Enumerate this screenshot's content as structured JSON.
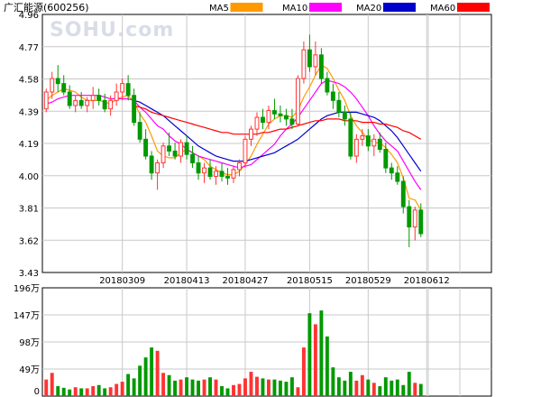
{
  "title": "广汇能源(600256)",
  "watermark": "SOHU.com",
  "legend": [
    {
      "label": "MA5",
      "color": "#ff9900"
    },
    {
      "label": "MA10",
      "color": "#ff00ff"
    },
    {
      "label": "MA20",
      "color": "#0000cc"
    },
    {
      "label": "MA60",
      "color": "#ff0000"
    }
  ],
  "colors": {
    "up": "#ff3333",
    "down": "#009900",
    "grid": "#c8c8c8",
    "border": "#000000"
  },
  "chart_data": [
    {
      "type": "candlestick",
      "price_ticks": [
        "4.96",
        "4.77",
        "4.58",
        "4.39",
        "4.19",
        "4.00",
        "3.81",
        "3.62",
        "3.43"
      ],
      "ylim": [
        3.43,
        4.96
      ],
      "date_labels": [
        {
          "label": "20180309",
          "index": 13
        },
        {
          "label": "20180413",
          "index": 24
        },
        {
          "label": "20180427",
          "index": 34
        },
        {
          "label": "20180515",
          "index": 45
        },
        {
          "label": "20180529",
          "index": 55
        },
        {
          "label": "20180612",
          "index": 65
        }
      ],
      "ohlc": [
        [
          4.4,
          4.52,
          4.38,
          4.5
        ],
        [
          4.5,
          4.62,
          4.46,
          4.58
        ],
        [
          4.58,
          4.66,
          4.5,
          4.55
        ],
        [
          4.55,
          4.6,
          4.48,
          4.5
        ],
        [
          4.5,
          4.54,
          4.4,
          4.42
        ],
        [
          4.42,
          4.48,
          4.38,
          4.45
        ],
        [
          4.45,
          4.5,
          4.4,
          4.42
        ],
        [
          4.42,
          4.47,
          4.38,
          4.45
        ],
        [
          4.45,
          4.53,
          4.4,
          4.48
        ],
        [
          4.48,
          4.52,
          4.42,
          4.45
        ],
        [
          4.45,
          4.49,
          4.38,
          4.4
        ],
        [
          4.4,
          4.48,
          4.36,
          4.45
        ],
        [
          4.45,
          4.55,
          4.42,
          4.5
        ],
        [
          4.5,
          4.58,
          4.45,
          4.55
        ],
        [
          4.55,
          4.6,
          4.45,
          4.48
        ],
        [
          4.48,
          4.52,
          4.3,
          4.32
        ],
        [
          4.32,
          4.38,
          4.2,
          4.22
        ],
        [
          4.22,
          4.28,
          4.1,
          4.12
        ],
        [
          4.12,
          4.15,
          3.98,
          4.02
        ],
        [
          4.02,
          4.1,
          3.92,
          4.08
        ],
        [
          4.08,
          4.2,
          4.05,
          4.18
        ],
        [
          4.18,
          4.26,
          4.12,
          4.15
        ],
        [
          4.15,
          4.2,
          4.1,
          4.12
        ],
        [
          4.12,
          4.22,
          4.08,
          4.2
        ],
        [
          4.2,
          4.24,
          4.1,
          4.13
        ],
        [
          4.13,
          4.18,
          4.05,
          4.08
        ],
        [
          4.08,
          4.12,
          3.98,
          4.02
        ],
        [
          4.02,
          4.08,
          3.96,
          4.05
        ],
        [
          4.05,
          4.1,
          3.98,
          4.0
        ],
        [
          4.0,
          4.06,
          3.95,
          4.03
        ],
        [
          4.03,
          4.08,
          3.97,
          4.0
        ],
        [
          4.0,
          4.05,
          3.95,
          3.99
        ],
        [
          3.99,
          4.06,
          3.96,
          4.04
        ],
        [
          4.04,
          4.1,
          4.0,
          4.08
        ],
        [
          4.08,
          4.24,
          4.05,
          4.22
        ],
        [
          4.22,
          4.3,
          4.18,
          4.28
        ],
        [
          4.28,
          4.38,
          4.24,
          4.35
        ],
        [
          4.35,
          4.4,
          4.28,
          4.32
        ],
        [
          4.32,
          4.42,
          4.28,
          4.39
        ],
        [
          4.39,
          4.46,
          4.34,
          4.37
        ],
        [
          4.37,
          4.42,
          4.32,
          4.36
        ],
        [
          4.36,
          4.4,
          4.3,
          4.34
        ],
        [
          4.34,
          4.4,
          4.28,
          4.31
        ],
        [
          4.31,
          4.6,
          4.3,
          4.58
        ],
        [
          4.58,
          4.8,
          4.55,
          4.75
        ],
        [
          4.75,
          4.84,
          4.62,
          4.65
        ],
        [
          4.65,
          4.8,
          4.6,
          4.72
        ],
        [
          4.72,
          4.76,
          4.55,
          4.58
        ],
        [
          4.58,
          4.62,
          4.48,
          4.5
        ],
        [
          4.5,
          4.55,
          4.4,
          4.45
        ],
        [
          4.45,
          4.5,
          4.35,
          4.38
        ],
        [
          4.38,
          4.42,
          4.3,
          4.34
        ],
        [
          4.34,
          4.38,
          4.1,
          4.12
        ],
        [
          4.12,
          4.25,
          4.08,
          4.22
        ],
        [
          4.22,
          4.28,
          4.18,
          4.24
        ],
        [
          4.24,
          4.28,
          4.15,
          4.18
        ],
        [
          4.18,
          4.25,
          4.12,
          4.22
        ],
        [
          4.22,
          4.26,
          4.14,
          4.16
        ],
        [
          4.16,
          4.2,
          4.02,
          4.05
        ],
        [
          4.05,
          4.08,
          3.98,
          4.02
        ],
        [
          4.02,
          4.06,
          3.95,
          3.97
        ],
        [
          3.97,
          4.0,
          3.78,
          3.82
        ],
        [
          3.82,
          3.86,
          3.58,
          3.7
        ],
        [
          3.7,
          3.82,
          3.62,
          3.8
        ],
        [
          3.8,
          3.84,
          3.64,
          3.66
        ]
      ],
      "ma5": [
        4.45,
        4.48,
        4.5,
        4.52,
        4.51,
        4.5,
        4.47,
        4.45,
        4.45,
        4.45,
        4.44,
        4.43,
        4.46,
        4.47,
        4.48,
        4.44,
        4.37,
        4.32,
        4.24,
        4.15,
        4.12,
        4.11,
        4.11,
        4.14,
        4.16,
        4.14,
        4.12,
        4.1,
        4.06,
        4.04,
        4.02,
        4.01,
        4.01,
        4.03,
        4.07,
        4.12,
        4.19,
        4.25,
        4.31,
        4.34,
        4.36,
        4.36,
        4.35,
        4.39,
        4.47,
        4.53,
        4.6,
        4.66,
        4.64,
        4.58,
        4.51,
        4.45,
        4.36,
        4.3,
        4.26,
        4.22,
        4.2,
        4.2,
        4.17,
        4.13,
        4.08,
        3.99,
        3.87,
        3.86,
        3.8
      ],
      "ma10": [
        4.43,
        4.44,
        4.46,
        4.47,
        4.48,
        4.48,
        4.48,
        4.48,
        4.48,
        4.48,
        4.47,
        4.46,
        4.46,
        4.46,
        4.46,
        4.45,
        4.41,
        4.38,
        4.34,
        4.3,
        4.28,
        4.24,
        4.21,
        4.19,
        4.16,
        4.14,
        4.12,
        4.11,
        4.1,
        4.09,
        4.08,
        4.07,
        4.06,
        4.05,
        4.06,
        4.07,
        4.1,
        4.13,
        4.16,
        4.19,
        4.24,
        4.28,
        4.31,
        4.35,
        4.4,
        4.45,
        4.5,
        4.55,
        4.57,
        4.56,
        4.55,
        4.53,
        4.5,
        4.46,
        4.41,
        4.36,
        4.3,
        4.25,
        4.21,
        4.18,
        4.15,
        4.09,
        4.03,
        3.97,
        3.92
      ],
      "ma20": [
        null,
        null,
        null,
        null,
        null,
        null,
        null,
        null,
        null,
        null,
        null,
        null,
        null,
        null,
        null,
        4.45,
        4.44,
        4.42,
        4.4,
        4.38,
        4.36,
        4.33,
        4.3,
        4.27,
        4.24,
        4.21,
        4.18,
        4.16,
        4.14,
        4.12,
        4.11,
        4.1,
        4.09,
        4.09,
        4.09,
        4.1,
        4.11,
        4.12,
        4.13,
        4.14,
        4.16,
        4.18,
        4.2,
        4.22,
        4.25,
        4.28,
        4.31,
        4.34,
        4.36,
        4.37,
        4.38,
        4.38,
        4.38,
        4.38,
        4.37,
        4.36,
        4.35,
        4.33,
        4.3,
        4.27,
        4.23,
        4.18,
        4.13,
        4.08,
        4.03
      ],
      "ma60": [
        null,
        null,
        null,
        null,
        null,
        null,
        null,
        null,
        null,
        null,
        null,
        null,
        null,
        null,
        null,
        4.42,
        4.41,
        4.4,
        4.38,
        4.37,
        4.36,
        4.35,
        4.34,
        4.33,
        4.32,
        4.31,
        4.3,
        4.29,
        4.28,
        4.27,
        4.26,
        4.26,
        4.25,
        4.25,
        4.25,
        4.25,
        4.25,
        4.26,
        4.26,
        4.27,
        4.28,
        4.28,
        4.29,
        4.3,
        4.31,
        4.32,
        4.33,
        4.33,
        4.34,
        4.34,
        4.34,
        4.33,
        4.33,
        4.33,
        4.32,
        4.32,
        4.32,
        4.31,
        4.31,
        4.3,
        4.29,
        4.27,
        4.26,
        4.24,
        4.22
      ]
    },
    {
      "type": "bar",
      "volume_ticks": [
        "196万",
        "147万",
        "98万",
        "49万",
        "0"
      ],
      "ylim": [
        0,
        196
      ],
      "unit": "万",
      "volume": [
        30,
        42,
        18,
        15,
        12,
        16,
        14,
        14,
        18,
        20,
        14,
        16,
        22,
        26,
        40,
        32,
        55,
        70,
        88,
        82,
        42,
        38,
        28,
        30,
        34,
        30,
        28,
        30,
        34,
        30,
        18,
        14,
        20,
        22,
        32,
        44,
        35,
        32,
        30,
        30,
        28,
        26,
        34,
        16,
        88,
        150,
        130,
        155,
        108,
        52,
        34,
        28,
        44,
        28,
        38,
        30,
        24,
        18,
        34,
        28,
        30,
        20,
        44,
        24,
        22
      ]
    }
  ]
}
